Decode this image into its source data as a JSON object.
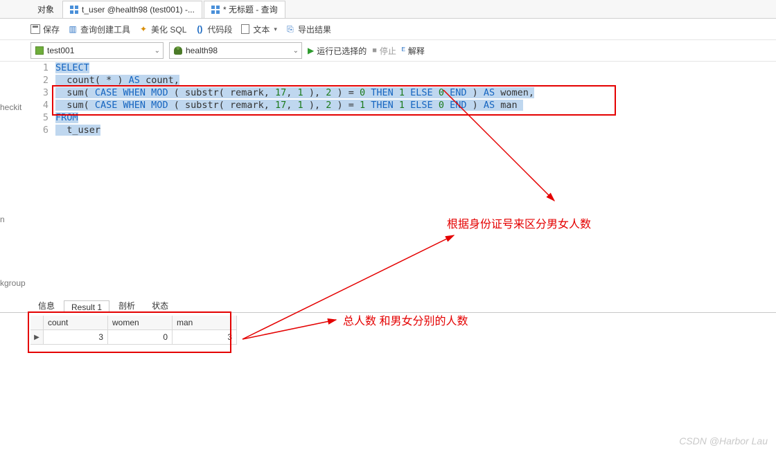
{
  "tabs": {
    "objects": "对象",
    "tab1": "t_user @health98 (test001) -...",
    "tab2": "* 无标题 - 查询"
  },
  "toolbar": {
    "save": "保存",
    "query_builder": "查询创建工具",
    "beautify": "美化 SQL",
    "snippet": "代码段",
    "text": "文本",
    "export": "导出结果"
  },
  "selectors": {
    "conn": "test001",
    "db": "health98",
    "run": "运行已选择的",
    "stop": "停止",
    "explain": "解释"
  },
  "code": {
    "l1": "SELECT",
    "l2_a": "count( * ) ",
    "l2_b": "AS",
    "l2_c": " count,",
    "l3_a": "sum( ",
    "l3_b": "CASE WHEN MOD",
    "l3_c": " ( substr( remark, ",
    "l3_d": "17",
    "l3_e": ", ",
    "l3_f": "1",
    "l3_g": " ), ",
    "l3_h": "2",
    "l3_i": " ) = ",
    "l3_j": "0",
    "l3_k": " THEN ",
    "l3_l": "1",
    "l3_m": " ELSE ",
    "l3_n": "0",
    "l3_o": " END ",
    "l3_p": ") ",
    "l3_q": "AS",
    "l3_r": " women,",
    "l4_j": "1",
    "l4_r": " man ",
    "l5": "FROM",
    "l6": "t_user"
  },
  "annotations": {
    "a1": "根据身份证号来区分男女人数",
    "a2": "总人数 和男女分别的人数"
  },
  "result_tabs": {
    "info": "信息",
    "result": "Result 1",
    "profile": "剖析",
    "status": "状态"
  },
  "grid": {
    "h1": "count",
    "h2": "women",
    "h3": "man",
    "v1": "3",
    "v2": "0",
    "v3": "3"
  },
  "sidecut": {
    "a": "n",
    "b": "kgroup"
  },
  "watermark": "CSDN @Harbor Lau"
}
